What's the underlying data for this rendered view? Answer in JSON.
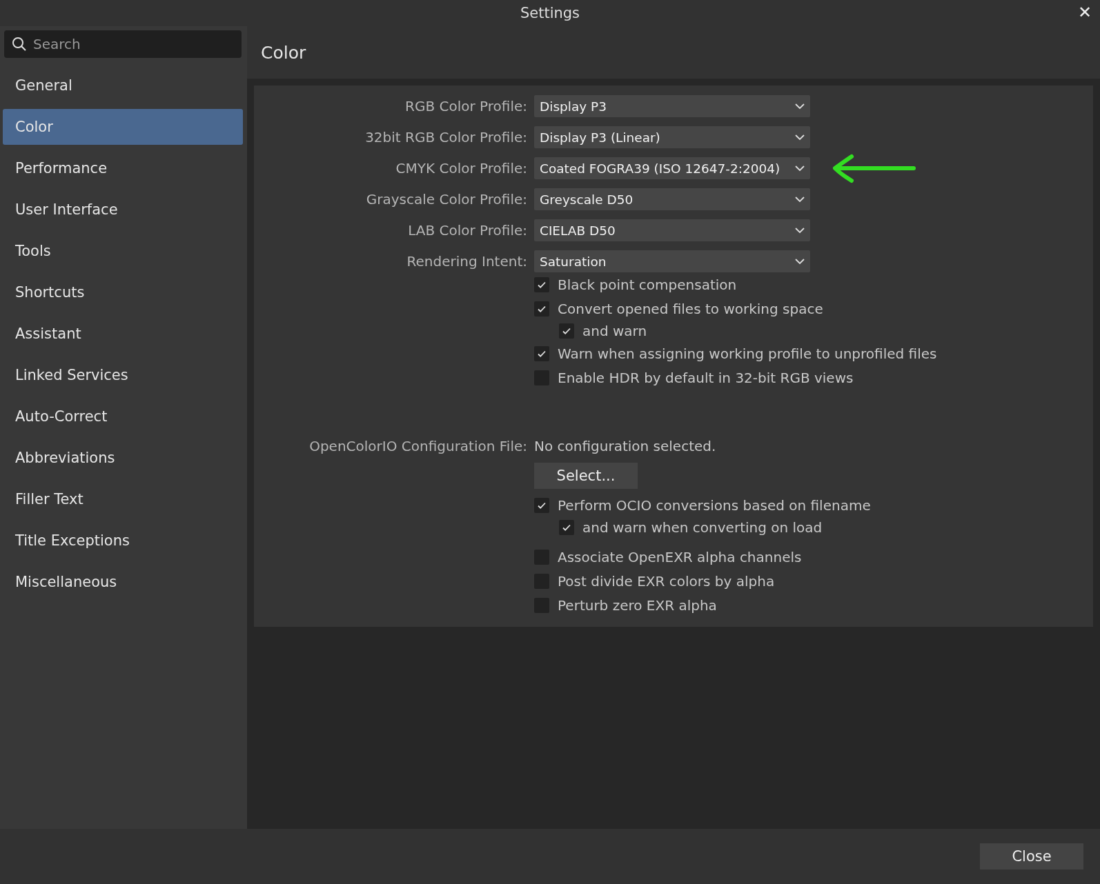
{
  "window": {
    "title": "Settings",
    "close": "✕"
  },
  "sidebar": {
    "search": {
      "placeholder": "Search"
    },
    "items": [
      {
        "label": "General",
        "selected": false
      },
      {
        "label": "Color",
        "selected": true
      },
      {
        "label": "Performance",
        "selected": false
      },
      {
        "label": "User Interface",
        "selected": false
      },
      {
        "label": "Tools",
        "selected": false
      },
      {
        "label": "Shortcuts",
        "selected": false
      },
      {
        "label": "Assistant",
        "selected": false
      },
      {
        "label": "Linked Services",
        "selected": false
      },
      {
        "label": "Auto-Correct",
        "selected": false
      },
      {
        "label": "Abbreviations",
        "selected": false
      },
      {
        "label": "Filler Text",
        "selected": false
      },
      {
        "label": "Title Exceptions",
        "selected": false
      },
      {
        "label": "Miscellaneous",
        "selected": false
      }
    ]
  },
  "page": {
    "title": "Color",
    "profiles": [
      {
        "label": "RGB Color Profile:",
        "value": "Display P3",
        "annotated": false
      },
      {
        "label": "32bit RGB Color Profile:",
        "value": "Display P3 (Linear)",
        "annotated": false
      },
      {
        "label": "CMYK Color Profile:",
        "value": "Coated FOGRA39 (ISO 12647-2:2004)",
        "annotated": true
      },
      {
        "label": "Grayscale Color Profile:",
        "value": "Greyscale D50",
        "annotated": false
      },
      {
        "label": "LAB Color Profile:",
        "value": "CIELAB D50",
        "annotated": false
      },
      {
        "label": "Rendering Intent:",
        "value": "Saturation",
        "annotated": false
      }
    ],
    "options": [
      {
        "label": "Black point compensation",
        "checked": true,
        "indented": false
      },
      {
        "label": "Convert opened files to working space",
        "checked": true,
        "indented": false
      },
      {
        "label": "and warn",
        "checked": true,
        "indented": true
      },
      {
        "label": "Warn when assigning working profile to unprofiled files",
        "checked": true,
        "indented": false
      },
      {
        "label": "Enable HDR by default in 32-bit RGB views",
        "checked": false,
        "indented": false
      }
    ],
    "ocio": {
      "label": "OpenColorIO Configuration File:",
      "value": "No configuration selected.",
      "button": "Select..."
    },
    "ocio_options": [
      {
        "label": "Perform OCIO conversions based on filename",
        "checked": true,
        "indented": false
      },
      {
        "label": "and warn when converting on load",
        "checked": true,
        "indented": true
      }
    ],
    "exr_options": [
      {
        "label": "Associate OpenEXR alpha channels",
        "checked": false,
        "indented": false
      },
      {
        "label": "Post divide EXR colors by alpha",
        "checked": false,
        "indented": false
      },
      {
        "label": "Perturb zero EXR alpha",
        "checked": false,
        "indented": false
      }
    ]
  },
  "footer": {
    "button": "Close"
  }
}
